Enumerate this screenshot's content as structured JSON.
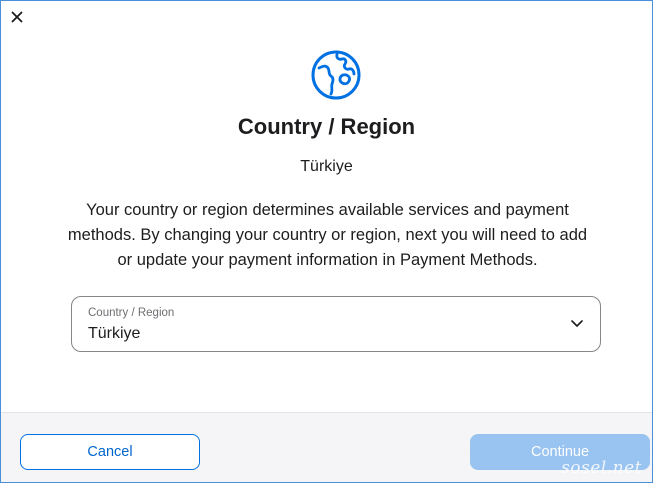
{
  "dialog": {
    "title": "Country / Region",
    "current_region": "Türkiye",
    "description": "Your country or region determines available services and payment methods. By changing your country or region, next you will need to add or update your payment information in Payment Methods."
  },
  "icons": {
    "close": "close-icon",
    "globe": "globe-icon",
    "dropdown": "chevron-down-icon"
  },
  "select": {
    "label": "Country / Region",
    "value": "Türkiye"
  },
  "footer": {
    "cancel_label": "Cancel",
    "continue_label": "Continue"
  },
  "watermark": "sosel.net",
  "colors": {
    "accent": "#0071e3",
    "continue_disabled": "#99c3f0",
    "footer_bg": "#f5f5f7"
  }
}
